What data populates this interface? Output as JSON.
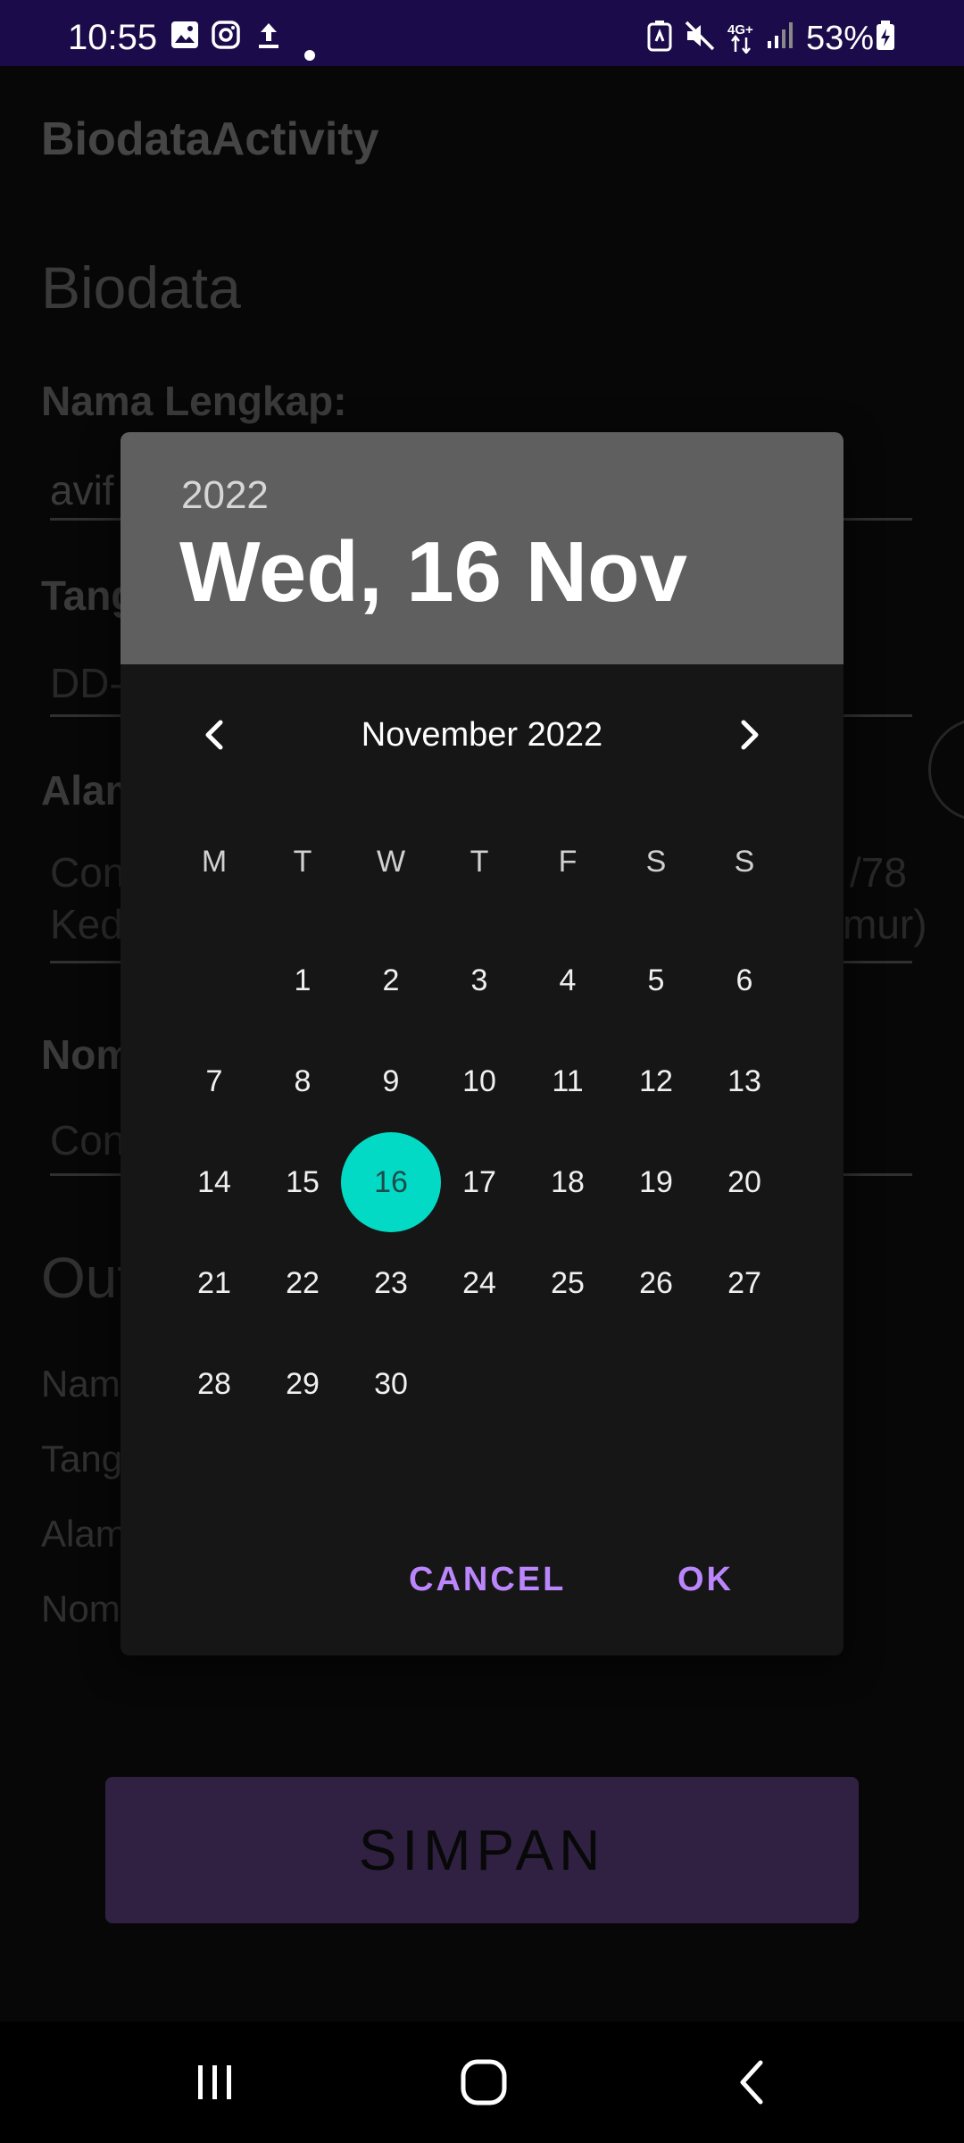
{
  "status_bar": {
    "time": "10:55",
    "battery": "53%",
    "network_label": "4G+",
    "icons": [
      "gallery-icon",
      "instagram-icon",
      "upload-icon",
      "dot-icon",
      "battery-saver-icon",
      "mute-icon",
      "network-4g-icon",
      "signal-icon",
      "battery-charging-icon"
    ]
  },
  "app": {
    "title": "BiodataActivity",
    "heading": "Biodata",
    "fields": {
      "name_label": "Nama Lengkap:",
      "name_value": "avif",
      "date_label": "Tang",
      "date_hint": "DD-",
      "address_label": "Alam",
      "address_hint_line1": "Con",
      "address_hint_line2": "Ked",
      "address_hint_tail1": "/78",
      "address_hint_tail2": "mur)",
      "phone_label": "Nom",
      "phone_hint": "Con"
    },
    "output": {
      "heading": "Out",
      "rows": [
        "Nam",
        "Tang",
        "Alam",
        "Nom"
      ]
    },
    "save_label": "SIMPAN"
  },
  "date_picker": {
    "year": "2022",
    "selected_date_text": "Wed, 16 Nov",
    "month_label": "November 2022",
    "weekdays": [
      "M",
      "T",
      "W",
      "T",
      "F",
      "S",
      "S"
    ],
    "first_weekday_offset": 1,
    "days_in_month": 30,
    "selected_day": 16,
    "cancel_label": "CANCEL",
    "ok_label": "OK"
  },
  "colors": {
    "accent": "#bb86fc",
    "selected_day": "#03dac5",
    "status_bar": "#1b0b4a",
    "save_button": "#4a3468",
    "dialog_header": "#5f5f5f"
  }
}
